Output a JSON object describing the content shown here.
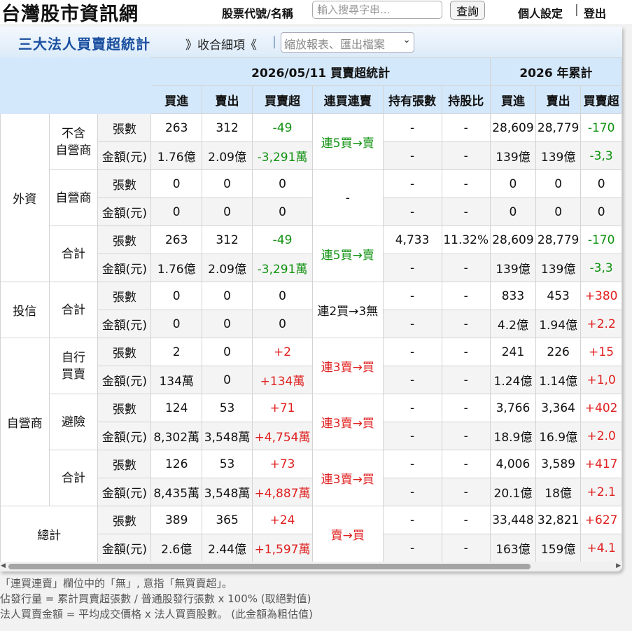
{
  "header": {
    "site_title": "台灣股市資訊網",
    "search_label": "股票代號/名稱",
    "search_placeholder": "輸入搜尋字串...",
    "query_button": "查詢",
    "settings_link": "個人設定",
    "separator": "|",
    "logout_link": "登出"
  },
  "panel": {
    "title": "三大法人買賣超統計",
    "merge_link": "》收合細項《",
    "pipe": "|",
    "report_select": "縮放報表、匯出檔案",
    "chevron": "⌄"
  },
  "table": {
    "group_headers": [
      "2026/05/11 買賣超統計",
      "2026 年累計"
    ],
    "col_headers": [
      "買進",
      "賣出",
      "買賣超",
      "連買連賣",
      "持有張數",
      "持股比",
      "買進",
      "賣出",
      "買賣超"
    ],
    "row_kinds": [
      "張數",
      "金額(元)"
    ],
    "sections": [
      {
        "group": "外資",
        "sub": "不含\n自營商",
        "qty": [
          "263",
          "312",
          "-49",
          "-",
          "-",
          "28,609",
          "28,779",
          "-170"
        ],
        "amt": [
          "1.76億",
          "2.09億",
          "-3,291萬",
          "-",
          "-",
          "139億",
          "139億",
          "-3,3"
        ],
        "streak": "連5買→賣",
        "streak_color": "g"
      },
      {
        "group": "外資",
        "sub": "自營商",
        "qty": [
          "0",
          "0",
          "0",
          "-",
          "-",
          "0",
          "0",
          "0"
        ],
        "amt": [
          "0",
          "0",
          "0",
          "-",
          "-",
          "0",
          "0",
          "0"
        ],
        "streak": "-",
        "streak_color": ""
      },
      {
        "group": "外資",
        "sub": "合計",
        "qty": [
          "263",
          "312",
          "-49",
          "4,733",
          "11.32%",
          "28,609",
          "28,779",
          "-170"
        ],
        "amt": [
          "1.76億",
          "2.09億",
          "-3,291萬",
          "-",
          "-",
          "139億",
          "139億",
          "-3,3"
        ],
        "streak": "連5買→賣",
        "streak_color": "g"
      },
      {
        "group": "投信",
        "sub": "合計",
        "qty": [
          "0",
          "0",
          "0",
          "-",
          "-",
          "833",
          "453",
          "+380"
        ],
        "amt": [
          "0",
          "0",
          "0",
          "-",
          "-",
          "4.2億",
          "1.94億",
          "+2.2"
        ],
        "streak": "連2買→3無",
        "streak_color": ""
      },
      {
        "group": "自營商",
        "sub": "自行\n買賣",
        "qty": [
          "2",
          "0",
          "+2",
          "-",
          "-",
          "241",
          "226",
          "+15"
        ],
        "amt": [
          "134萬",
          "0",
          "+134萬",
          "-",
          "-",
          "1.24億",
          "1.14億",
          "+1,0"
        ],
        "streak": "連3賣→買",
        "streak_color": "r"
      },
      {
        "group": "自營商",
        "sub": "避險",
        "qty": [
          "124",
          "53",
          "+71",
          "-",
          "-",
          "3,766",
          "3,364",
          "+402"
        ],
        "amt": [
          "8,302萬",
          "3,548萬",
          "+4,754萬",
          "-",
          "-",
          "18.9億",
          "16.9億",
          "+2.0"
        ],
        "streak": "連3賣→買",
        "streak_color": "r"
      },
      {
        "group": "自營商",
        "sub": "合計",
        "qty": [
          "126",
          "53",
          "+73",
          "-",
          "-",
          "4,006",
          "3,589",
          "+417"
        ],
        "amt": [
          "8,435萬",
          "3,548萬",
          "+4,887萬",
          "-",
          "-",
          "20.1億",
          "18億",
          "+2.1"
        ],
        "streak": "連3賣→買",
        "streak_color": "r"
      },
      {
        "group": "總計",
        "sub": "",
        "qty": [
          "389",
          "365",
          "+24",
          "-",
          "-",
          "33,448",
          "32,821",
          "+627"
        ],
        "amt": [
          "2.6億",
          "2.44億",
          "+1,597萬",
          "-",
          "-",
          "163億",
          "159億",
          "+4.1"
        ],
        "streak": "賣→買",
        "streak_color": "r"
      }
    ]
  },
  "notes": [
    "「連買連賣」欄位中的「無」, 意指「無買賣超」。",
    "佔發行量 = 累計買賣超張數 / 普通股發行張數 x 100% (取絕對值)",
    "法人買賣金額 = 平均成交價格 x 法人買賣股數。 (此金額為粗估值)"
  ],
  "scrollbar": {
    "left_arrow": "◀",
    "right_arrow": "▶"
  }
}
